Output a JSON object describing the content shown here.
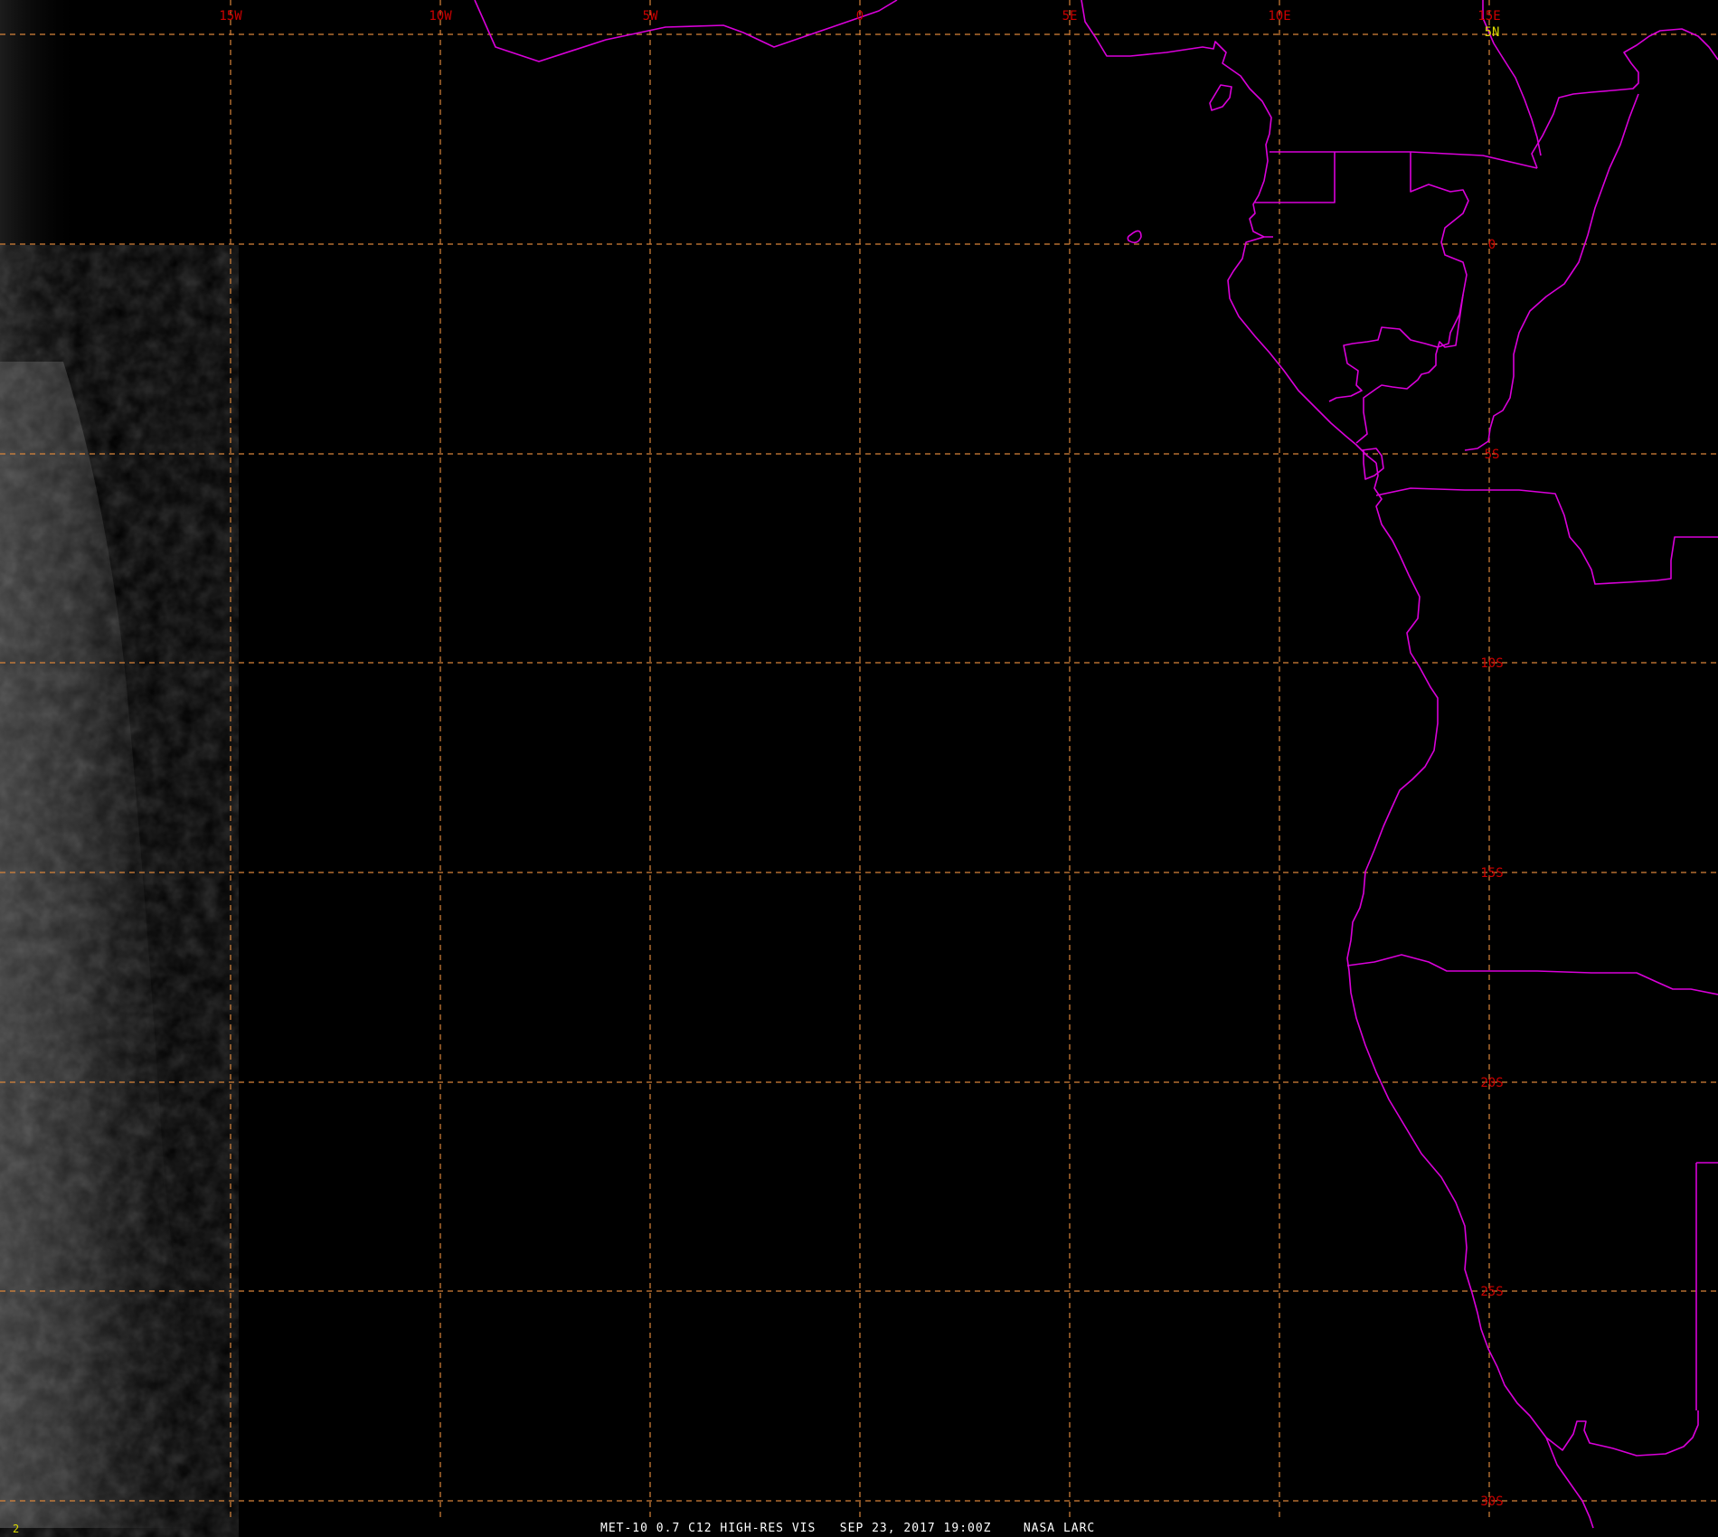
{
  "colors": {
    "background": "#000000",
    "graticule": "#d8843a",
    "boundary": "#d900d9",
    "lon_label": "#cc0000",
    "lat_label": "#cc0000",
    "top_lat_label": "#d9d900",
    "frame_number": "#d9d900",
    "caption": "#ffffff"
  },
  "longitude_labels": [
    "15W",
    "10W",
    "5W",
    "0",
    "5E",
    "10E",
    "15E"
  ],
  "latitude_labels": [
    "5N",
    "0",
    "5S",
    "10S",
    "15S",
    "20S",
    "25S",
    "30S"
  ],
  "frame_number": "2",
  "caption": "MET-10 0.7 C12 HIGH-RES VIS   SEP 23, 2017 19:00Z    NASA LARC",
  "map_layers": {
    "graticule": "dashed",
    "boundaries": "coastlines and country borders",
    "imagery": "visible channel, dark (night side), faint cloud texture at west edge"
  }
}
